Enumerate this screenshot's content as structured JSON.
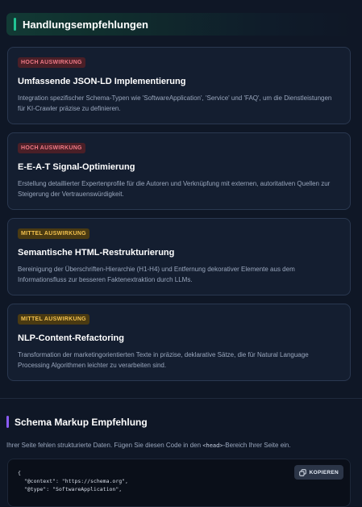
{
  "recommendations": {
    "title": "Handlungsempfehlungen",
    "items": [
      {
        "badge": "HOCH AUSWIRKUNG",
        "level": "high",
        "title": "Umfassende JSON-LD Implementierung",
        "description": "Integration spezifischer Schema-Typen wie 'SoftwareApplication', 'Service' und 'FAQ', um die Dienstleistungen für KI-Crawler präzise zu definieren."
      },
      {
        "badge": "HOCH AUSWIRKUNG",
        "level": "high",
        "title": "E-E-A-T Signal-Optimierung",
        "description": "Erstellung detaillierter Expertenprofile für die Autoren und Verknüpfung mit externen, autoritativen Quellen zur Steigerung der Vertrauenswürdigkeit."
      },
      {
        "badge": "MITTEL AUSWIRKUNG",
        "level": "medium",
        "title": "Semantische HTML-Restrukturierung",
        "description": "Bereinigung der Überschriften-Hierarchie (H1-H4) und Entfernung dekorativer Elemente aus dem Informationsfluss zur besseren Faktenextraktion durch LLMs."
      },
      {
        "badge": "MITTEL AUSWIRKUNG",
        "level": "medium",
        "title": "NLP-Content-Refactoring",
        "description": "Transformation der marketingorientierten Texte in präzise, deklarative Sätze, die für Natural Language Processing Algorithmen leichter zu verarbeiten sind."
      }
    ]
  },
  "schema": {
    "title": "Schema Markup Empfehlung",
    "desc_before": "Ihrer Seite fehlen strukturierte Daten. Fügen Sie diesen Code in den ",
    "desc_tag": "<head>",
    "desc_after": "-Bereich Ihrer Seite ein.",
    "copy_label": "KOPIEREN",
    "code_lines": [
      "{",
      "  \"@context\": \"https://schema.org\",",
      "  \"@type\": \"SoftwareApplication\","
    ]
  },
  "colors": {
    "accent_green": "#21c494",
    "accent_purple": "#8b5cf6",
    "badge_high": "#f07a86",
    "badge_medium": "#f2c14e"
  },
  "icons": {
    "copy": "copy-icon"
  }
}
